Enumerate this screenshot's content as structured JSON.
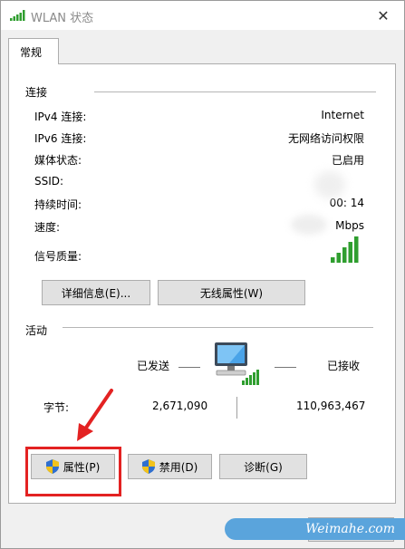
{
  "window": {
    "title": "WLAN 状态",
    "close_glyph": "✕"
  },
  "tabs": [
    {
      "label": "常规"
    }
  ],
  "connection": {
    "header": "连接",
    "rows": [
      {
        "label": "IPv4 连接:",
        "value": "Internet"
      },
      {
        "label": "IPv6 连接:",
        "value": "无网络访问权限"
      },
      {
        "label": "媒体状态:",
        "value": "已启用"
      },
      {
        "label": "SSID:",
        "value": ""
      },
      {
        "label": "持续时间:",
        "value": "00:  14"
      },
      {
        "label": "速度:",
        "value": "Mbps"
      },
      {
        "label": "信号质量:",
        "value": ""
      }
    ],
    "signal_level": "5/5",
    "buttons": {
      "details": "详细信息(E)...",
      "wireless_properties": "无线属性(W)"
    }
  },
  "activity": {
    "header": "活动",
    "sent_label": "已发送",
    "received_label": "已接收",
    "bytes_label": "字节:",
    "bytes_sent": "2,671,090",
    "bytes_received": "110,963,467"
  },
  "actions": {
    "properties": "属性(P)",
    "disable": "禁用(D)",
    "diagnose": "诊断(G)"
  },
  "watermark": "Weimahe.com",
  "colors": {
    "highlight": "#e32222",
    "signal": "#2f9e2f",
    "watermark_bg": "#5aa4dc"
  }
}
